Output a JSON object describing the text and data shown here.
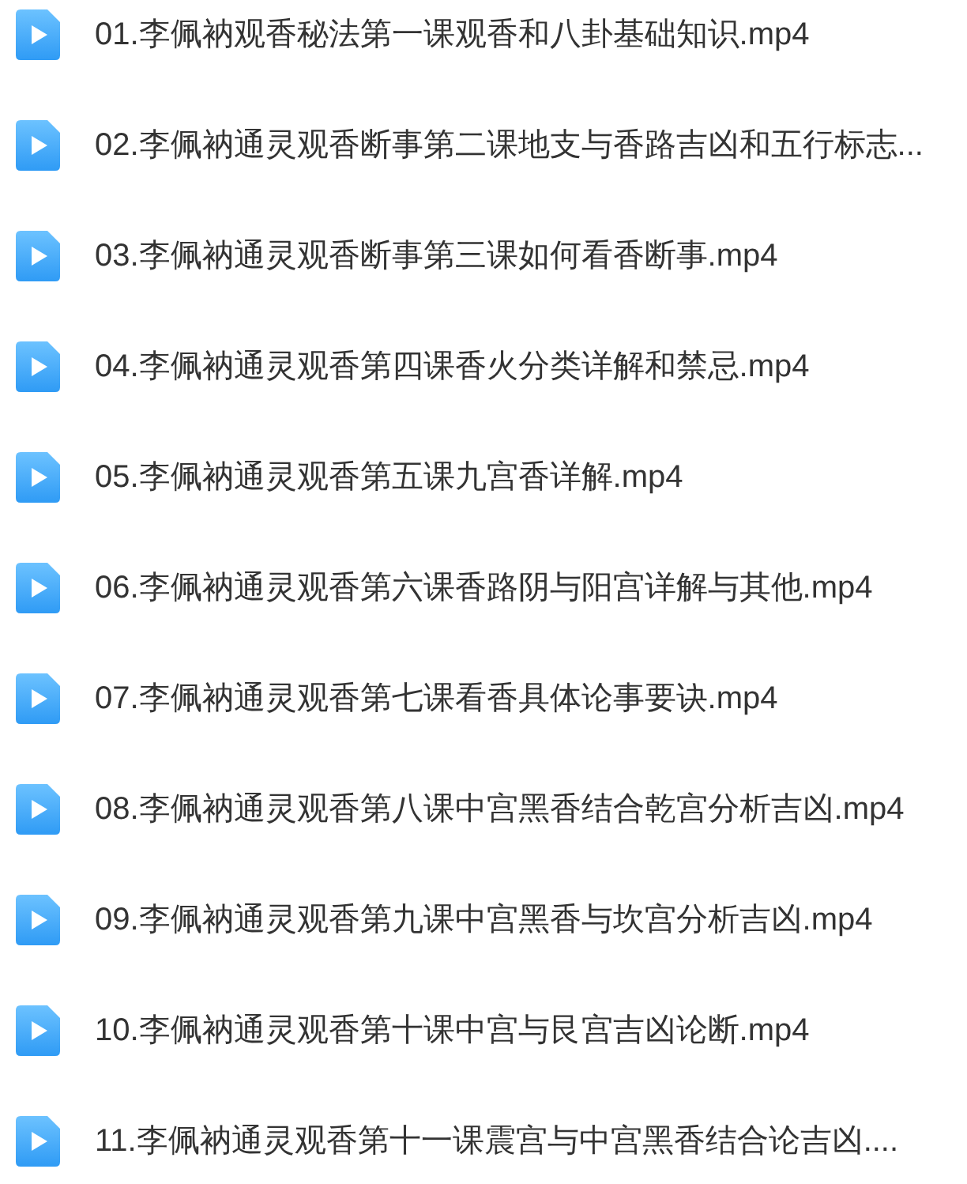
{
  "files": [
    {
      "name": "01.李佩衲观香秘法第一课观香和八卦基础知识.mp4"
    },
    {
      "name": "02.李佩衲通灵观香断事第二课地支与香路吉凶和五行标志..."
    },
    {
      "name": "03.李佩衲通灵观香断事第三课如何看香断事.mp4"
    },
    {
      "name": "04.李佩衲通灵观香第四课香火分类详解和禁忌.mp4"
    },
    {
      "name": "05.李佩衲通灵观香第五课九宫香详解.mp4"
    },
    {
      "name": "06.李佩衲通灵观香第六课香路阴与阳宫详解与其他.mp4"
    },
    {
      "name": "07.李佩衲通灵观香第七课看香具体论事要诀.mp4"
    },
    {
      "name": "08.李佩衲通灵观香第八课中宫黑香结合乾宫分析吉凶.mp4"
    },
    {
      "name": "09.李佩衲通灵观香第九课中宫黑香与坎宫分析吉凶.mp4"
    },
    {
      "name": "10.李佩衲通灵观香第十课中宫与艮宫吉凶论断.mp4"
    },
    {
      "name": "11.李佩衲通灵观香第十一课震宫与中宫黑香结合论吉凶...."
    }
  ]
}
